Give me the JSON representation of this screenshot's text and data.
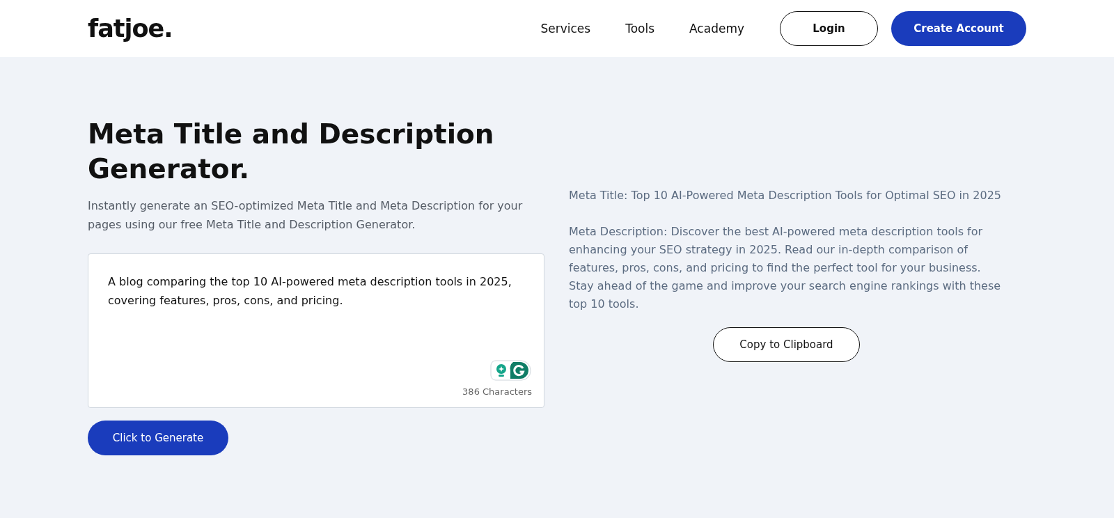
{
  "header": {
    "logo": "fatjoe.",
    "nav": [
      "Services",
      "Tools",
      "Academy"
    ],
    "login": "Login",
    "create_account": "Create Account"
  },
  "hero": {
    "title": "Meta Title and Description Generator.",
    "subtitle": "Instantly generate an SEO-optimized Meta Title and Meta Description for your pages using our free Meta Title and Description Generator.",
    "input": {
      "value": "A blog comparing the top 10 AI-powered meta description tools in 2025, covering features, pros, cons, and pricing.",
      "counter": "386 Characters"
    },
    "generate_button": "Click to Generate"
  },
  "result": {
    "meta_title": "Meta Title: Top 10 AI-Powered Meta Description Tools for Optimal SEO in 2025",
    "meta_description": "Meta Description: Discover the best AI-powered meta description tools for enhancing your SEO strategy in 2025. Read our in-depth comparison of features, pros, cons, and pricing to find the perfect tool for your business. Stay ahead of the game and improve your search engine rankings with these top 10 tools.",
    "copy_button": "Copy to Clipboard"
  }
}
